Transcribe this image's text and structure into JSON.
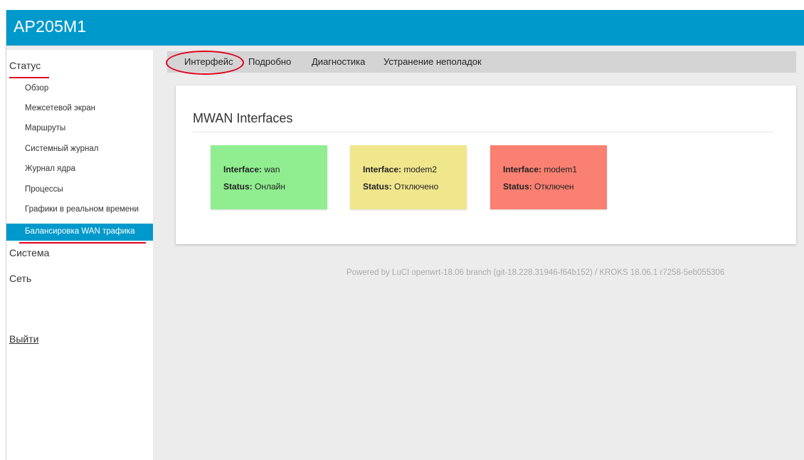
{
  "header": {
    "title": "AP205M1"
  },
  "sidebar": {
    "status_label": "Статус",
    "status_items": [
      {
        "label": "Обзор"
      },
      {
        "label": "Межсетевой экран"
      },
      {
        "label": "Маршруты"
      },
      {
        "label": "Системный журнал"
      },
      {
        "label": "Журнал ядра"
      },
      {
        "label": "Процессы"
      },
      {
        "label": "Графики в реальном времени"
      }
    ],
    "active_item": "Балансировка WAN трафика",
    "system_label": "Система",
    "network_label": "Сеть",
    "logout_label": "Выйти"
  },
  "tabs": [
    {
      "label": "Интерфейс"
    },
    {
      "label": "Подробно"
    },
    {
      "label": "Диагностика"
    },
    {
      "label": "Устранение неполадок"
    }
  ],
  "main": {
    "title": "MWAN Interfaces",
    "interface_key": "Interface:",
    "status_key": "Status:",
    "interfaces": [
      {
        "name": "wan",
        "status": "Онлайн",
        "color": "#90ee90"
      },
      {
        "name": "modem2",
        "status": "Отключено",
        "color": "#f0e68c"
      },
      {
        "name": "modem1",
        "status": "Отключен",
        "color": "#fa8072"
      }
    ]
  },
  "footer": {
    "text": "Powered by LuCI openwrt-18.06 branch (git-18.228.31946-f64b152) / KROKS 18.06.1 r7258-5eb055306"
  },
  "colors": {
    "accent": "#0099cc",
    "highlight_red": "#e0001b",
    "page_bg": "#ececec"
  }
}
